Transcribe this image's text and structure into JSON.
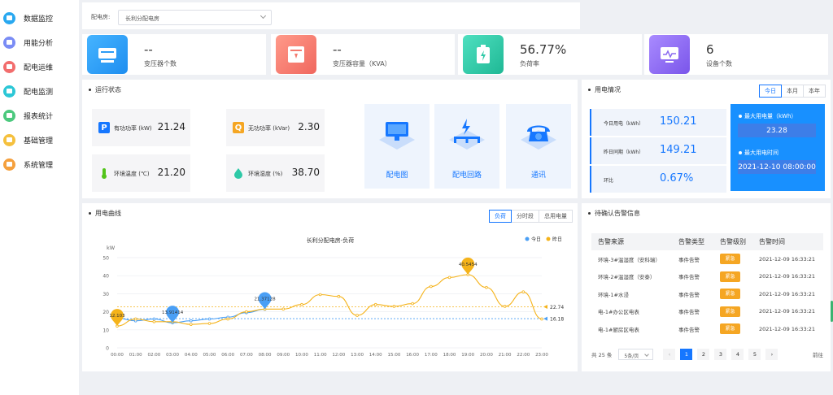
{
  "sidebar": {
    "items": [
      {
        "label": "数据监控",
        "color": "#29a8f0"
      },
      {
        "label": "用能分析",
        "color": "#7a8cf5"
      },
      {
        "label": "配电运维",
        "color": "#f26d6d"
      },
      {
        "label": "配电监测",
        "color": "#2cc7d6"
      },
      {
        "label": "报表统计",
        "color": "#4cc97e"
      },
      {
        "label": "基础管理",
        "color": "#f5c03d"
      },
      {
        "label": "系统管理",
        "color": "#f5a03d"
      }
    ]
  },
  "filter": {
    "label": "配电房:",
    "value": "长利分配电房"
  },
  "kpis": [
    {
      "value": "--",
      "label": "变压器个数",
      "color": "#2d9cf5",
      "icon": "server-icon"
    },
    {
      "value": "--",
      "label": "变压器容量（KVA）",
      "color": "#f47a6e",
      "icon": "transformer-icon"
    },
    {
      "value": "56.77%",
      "label": "负荷率",
      "color": "#2ec9a7",
      "icon": "battery-icon"
    },
    {
      "value": "6",
      "label": "设备个数",
      "color": "#8b6cf0",
      "icon": "monitor-icon"
    }
  ],
  "run_status": {
    "title": "运行状态",
    "metrics": [
      {
        "badge": "P",
        "label": "有功功率 (kW)",
        "value": "21.24",
        "color": "#1677ff"
      },
      {
        "badge": "Q",
        "label": "无功功率 (kVar)",
        "value": "2.30",
        "color": "#f5a623"
      },
      {
        "badge": "",
        "label": "环境温度 (℃)",
        "value": "21.20",
        "color": "#52c41a",
        "icon": "thermometer-icon"
      },
      {
        "badge": "",
        "label": "环境湿度 (%)",
        "value": "38.70",
        "color": "#2ec9a7",
        "icon": "humidity-icon"
      }
    ],
    "buttons": [
      "配电图",
      "配电回路",
      "通讯"
    ]
  },
  "usage": {
    "title": "用电情况",
    "tabs": [
      "今日",
      "本月",
      "本年"
    ],
    "active_tab": "今日",
    "rows": [
      {
        "label": "今日用电（kWh）",
        "value": "150.21"
      },
      {
        "label": "昨日同期（kWh）",
        "value": "149.21"
      },
      {
        "label": "环比",
        "value": "0.67%"
      }
    ],
    "max_label": "最大用电量（kWh）",
    "max_value": "23.28",
    "max_time_label": "最大用电时间",
    "max_time_value": "2021-12-10 08:00:00"
  },
  "curve": {
    "title": "用电曲线",
    "tabs": [
      "负荷",
      "分时段",
      "总用电量"
    ],
    "active_tab": "负荷"
  },
  "chart_data": {
    "type": "line",
    "title": "长利分配电房-负荷",
    "ylabel": "kW",
    "ylim": [
      0,
      50
    ],
    "yticks": [
      "0",
      "10",
      "20",
      "30",
      "40",
      "50"
    ],
    "x": [
      "00:00",
      "01:00",
      "02:00",
      "03:00",
      "04:00",
      "05:00",
      "06:00",
      "07:00",
      "08:00",
      "09:00",
      "10:00",
      "11:00",
      "12:00",
      "13:00",
      "14:00",
      "15:00",
      "16:00",
      "17:00",
      "18:00",
      "19:00",
      "20:00",
      "21:00",
      "22:00",
      "23:00"
    ],
    "series": [
      {
        "name": "今日",
        "color": "#4a9ff5",
        "values": [
          16.5,
          15,
          16,
          13.9,
          15,
          16,
          17,
          19.5,
          21.4
        ]
      },
      {
        "name": "昨日",
        "color": "#f5b31a",
        "values": [
          12.1,
          16,
          14.5,
          14.5,
          13,
          13.5,
          16,
          20,
          21.5,
          21.5,
          24,
          29.5,
          28.5,
          18,
          24,
          23,
          24.5,
          34,
          39,
          40.6,
          33.5,
          23,
          31,
          16
        ]
      }
    ],
    "markers": [
      {
        "label": "12.103",
        "series": "昨日",
        "index": 0
      },
      {
        "label": "13.91414",
        "series": "今日",
        "index": 3
      },
      {
        "label": "21.37128",
        "series": "今日",
        "index": 8
      },
      {
        "label": "40.5454",
        "series": "昨日",
        "index": 19
      }
    ],
    "reference_lines": [
      {
        "value": 22.74,
        "label": "22.74",
        "series": "昨日"
      },
      {
        "value": 16.18,
        "label": "16.18",
        "series": "今日"
      }
    ],
    "legend": "top-right"
  },
  "alarms": {
    "title": "待确认告警信息",
    "columns": [
      "告警来源",
      "告警类型",
      "告警级别",
      "告警时间"
    ],
    "rows": [
      [
        "环境-3#温湿度（安科瑞）",
        "事件告警",
        "紧急",
        "2021-12-09 16:33:21"
      ],
      [
        "环境-2#温湿度（安泰）",
        "事件告警",
        "紧急",
        "2021-12-09 16:33:21"
      ],
      [
        "环境-1#水浸",
        "事件告警",
        "紧急",
        "2021-12-09 16:33:21"
      ],
      [
        "电-1#办公区电表",
        "事件告警",
        "紧急",
        "2021-12-09 16:33:21"
      ],
      [
        "电-1#厨房区电表",
        "事件告警",
        "紧急",
        "2021-12-09 16:33:21"
      ]
    ],
    "total": "共 25 条",
    "page_size": "5条/页",
    "pages": [
      "1",
      "2",
      "3",
      "4",
      "5"
    ],
    "active_page": "1",
    "prev": "‹",
    "next": "›",
    "jump": "前往"
  }
}
